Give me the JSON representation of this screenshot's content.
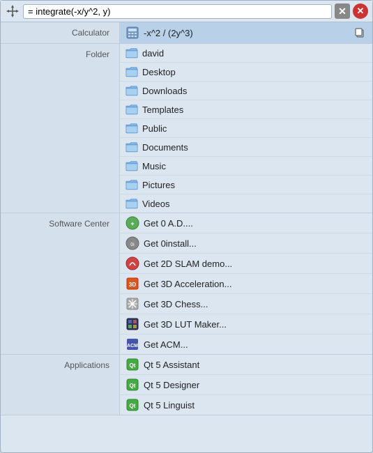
{
  "searchbar": {
    "query": "= integrate(-x/y^2, y)",
    "clear_label": "✕",
    "close_label": "✕"
  },
  "calculator": {
    "label": "Calculator",
    "result": "-x^2 / (2y^3)",
    "copy_title": "Copy"
  },
  "folder": {
    "label": "Folder",
    "items": [
      {
        "name": "david"
      },
      {
        "name": "Desktop"
      },
      {
        "name": "Downloads"
      },
      {
        "name": "Templates"
      },
      {
        "name": "Public"
      },
      {
        "name": "Documents"
      },
      {
        "name": "Music"
      },
      {
        "name": "Pictures"
      },
      {
        "name": "Videos"
      }
    ]
  },
  "software_center": {
    "label": "Software Center",
    "items": [
      {
        "name": "Get 0 A.D....",
        "color": "#5aaa5a"
      },
      {
        "name": "Get 0install...",
        "color": "#888"
      },
      {
        "name": "Get 2D SLAM demo...",
        "color": "#cc4444"
      },
      {
        "name": "Get 3D Acceleration...",
        "color": "#dd5522"
      },
      {
        "name": "Get 3D Chess...",
        "color": "#aaaaaa"
      },
      {
        "name": "Get 3D LUT Maker...",
        "color": "#333355"
      },
      {
        "name": "Get ACM...",
        "color": "#4455aa"
      }
    ]
  },
  "applications": {
    "label": "Applications",
    "items": [
      {
        "name": "Qt 5 Assistant",
        "color": "#44aa44"
      },
      {
        "name": "Qt 5 Designer",
        "color": "#44aa44"
      },
      {
        "name": "Qt 5 Linguist",
        "color": "#44aa44"
      }
    ]
  }
}
